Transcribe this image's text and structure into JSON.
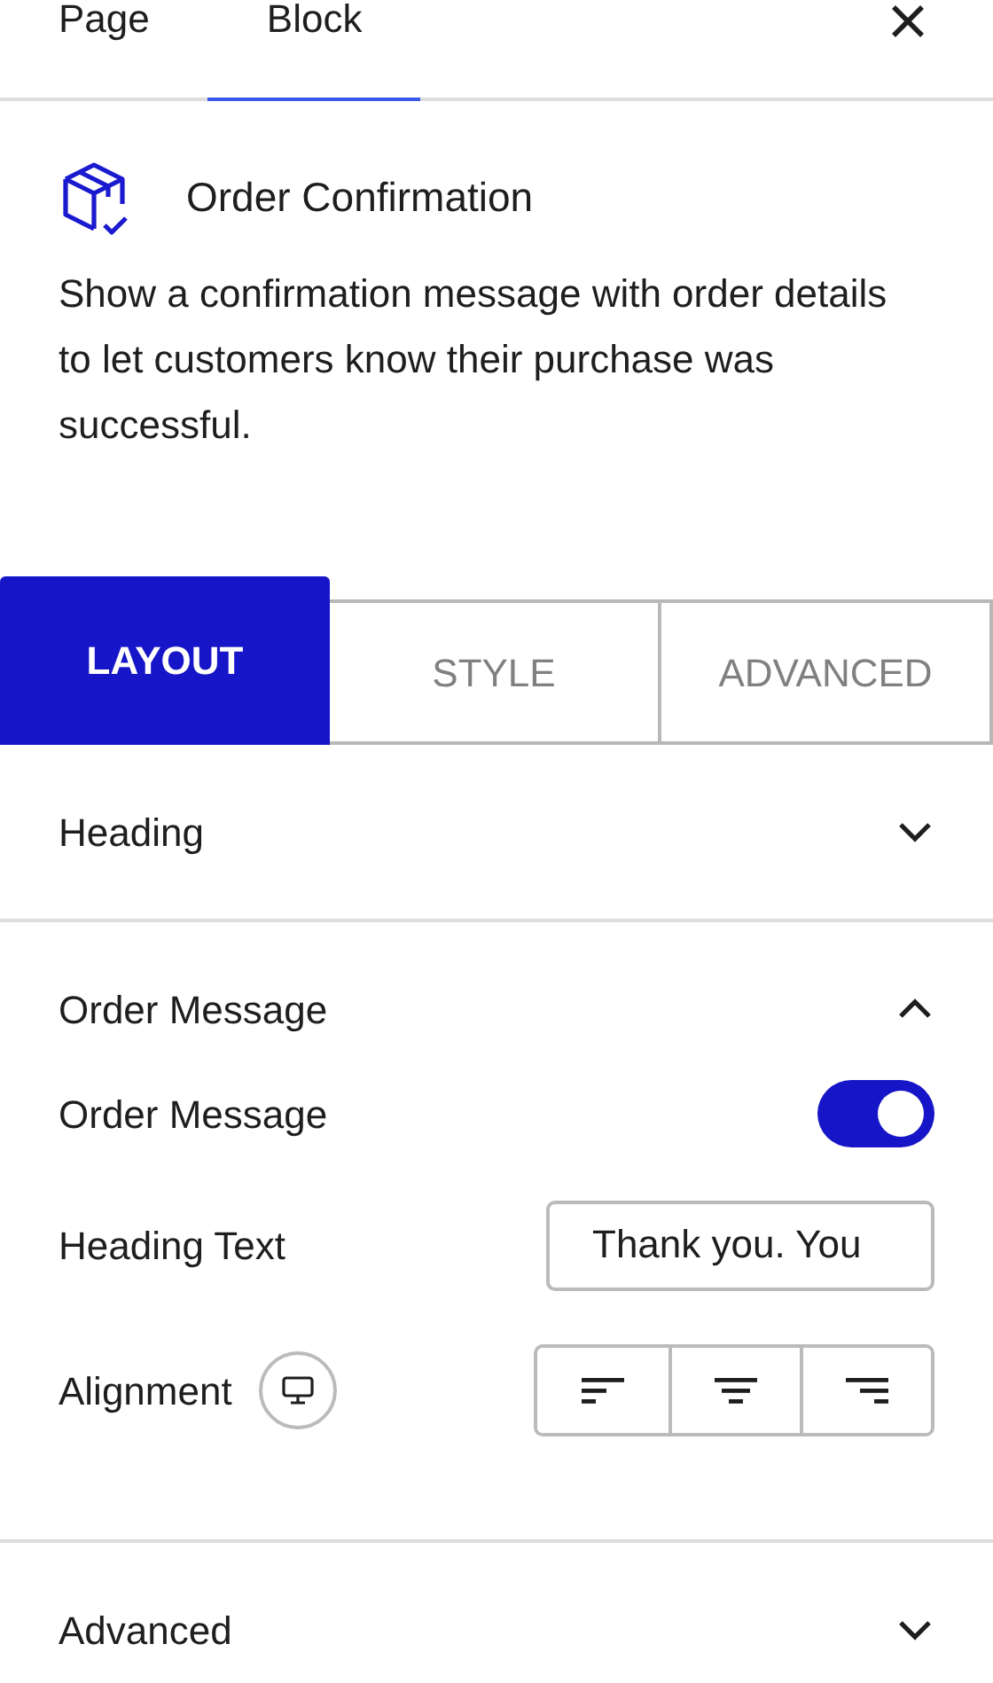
{
  "top_tabs": [
    {
      "label": "Page",
      "selected": false
    },
    {
      "label": "Block",
      "selected": true
    }
  ],
  "block": {
    "title": "Order Confirmation",
    "description": "Show a confirmation message with order details to let customers know their purchase was successful."
  },
  "panel_tabs": [
    {
      "label": "LAYOUT",
      "selected": true
    },
    {
      "label": "STYLE",
      "selected": false
    },
    {
      "label": "ADVANCED",
      "selected": false
    }
  ],
  "sections": [
    {
      "title": "Heading",
      "expanded": false
    },
    {
      "title": "Order Message",
      "expanded": true,
      "settings": [
        {
          "kind": "toggle",
          "label": "Order Message",
          "on": true
        },
        {
          "kind": "text",
          "label": "Heading Text",
          "value": "Thank you. You"
        },
        {
          "kind": "align",
          "label": "Alignment",
          "options": [
            {
              "selected": false
            },
            {
              "selected": false
            },
            {
              "selected": false
            }
          ]
        }
      ]
    },
    {
      "title": "Advanced",
      "expanded": false
    }
  ]
}
